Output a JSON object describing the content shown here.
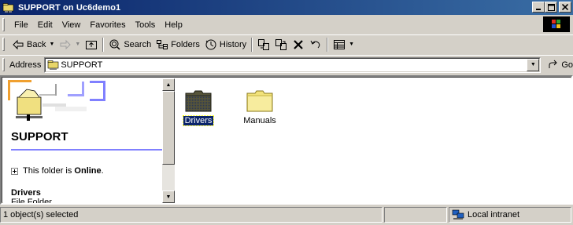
{
  "window": {
    "title": "SUPPORT on Uc6demo1",
    "controls": {
      "minimize": "0",
      "maximize": "1",
      "close": "r"
    }
  },
  "menubar": {
    "items": [
      "File",
      "Edit",
      "View",
      "Favorites",
      "Tools",
      "Help"
    ]
  },
  "toolbar": {
    "back_label": "Back",
    "search_label": "Search",
    "folders_label": "Folders",
    "history_label": "History"
  },
  "addressbar": {
    "label": "Address",
    "value": "SUPPORT",
    "go_label": "Go"
  },
  "leftpane": {
    "folder_title": "SUPPORT",
    "online_prefix": "This folder is ",
    "online_status": "Online",
    "online_suffix": ".",
    "selected_name": "Drivers",
    "selected_type": "File Folder"
  },
  "files": [
    {
      "name": "Drivers",
      "selected": true
    },
    {
      "name": "Manuals",
      "selected": false
    }
  ],
  "statusbar": {
    "selection": "1 object(s) selected",
    "zone": "Local intranet"
  },
  "colors": {
    "title_start": "#0a246a",
    "title_end": "#3a6ea5",
    "selection": "#0a246a",
    "face": "#d4d0c8"
  }
}
